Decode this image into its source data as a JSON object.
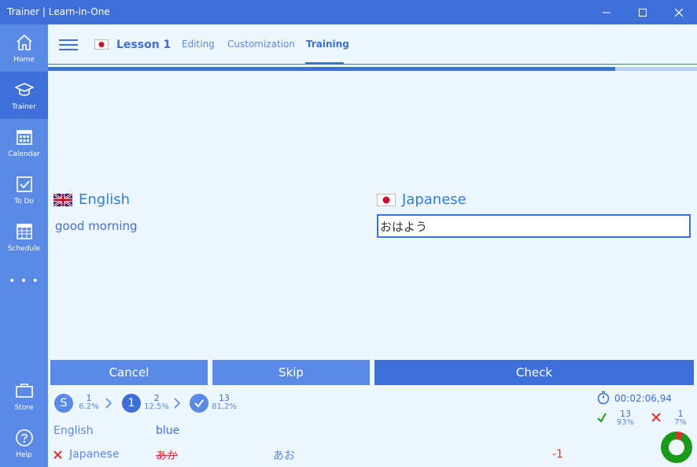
{
  "window": {
    "title": "Trainer | Learn-in-One"
  },
  "sidebar": {
    "items": [
      {
        "label": "Home",
        "icon": "home-icon"
      },
      {
        "label": "Trainer",
        "icon": "graduation-cap-icon"
      },
      {
        "label": "Calendar",
        "icon": "calendar-icon"
      },
      {
        "label": "To Do",
        "icon": "checkbox-icon"
      },
      {
        "label": "Schedule",
        "icon": "schedule-icon"
      },
      {
        "label": "• • •",
        "icon": "more-icon"
      },
      {
        "label": "Store",
        "icon": "briefcase-icon"
      },
      {
        "label": "Help",
        "icon": "help-icon"
      }
    ],
    "active_index": 1
  },
  "header": {
    "lesson_title": "Lesson 1",
    "tabs": [
      {
        "label": "Editing"
      },
      {
        "label": "Customization"
      },
      {
        "label": "Training"
      }
    ],
    "active_tab": 2,
    "progress": 0.874
  },
  "question": {
    "source_language": "English",
    "target_language": "Japanese",
    "prompt": "good morning",
    "answer_value": "おはよう"
  },
  "buttons": {
    "cancel": "Cancel",
    "skip": "Skip",
    "check": "Check"
  },
  "stats": {
    "stage_s": {
      "badge": "S",
      "count": "1",
      "percent": "6,2%"
    },
    "stage_1": {
      "badge": "1",
      "count": "2",
      "percent": "12,5%"
    },
    "stage_done": {
      "count": "13",
      "percent": "81,2%"
    },
    "timer": "00:02:06,94",
    "correct": {
      "count": "13",
      "percent": "93%"
    },
    "wrong": {
      "count": "1",
      "percent": "7%"
    },
    "accuracy": 0.93
  },
  "history": {
    "row1": {
      "language": "English",
      "value": "blue"
    },
    "row2": {
      "language": "Japanese",
      "given": "あか",
      "expected": "あお",
      "delta": "-1"
    }
  },
  "colors": {
    "primary": "#3f6fd8",
    "sidebar": "#5b8ae6",
    "button_light": "#5b8ae6",
    "error": "#e03030",
    "success": "#1a9a1a"
  }
}
